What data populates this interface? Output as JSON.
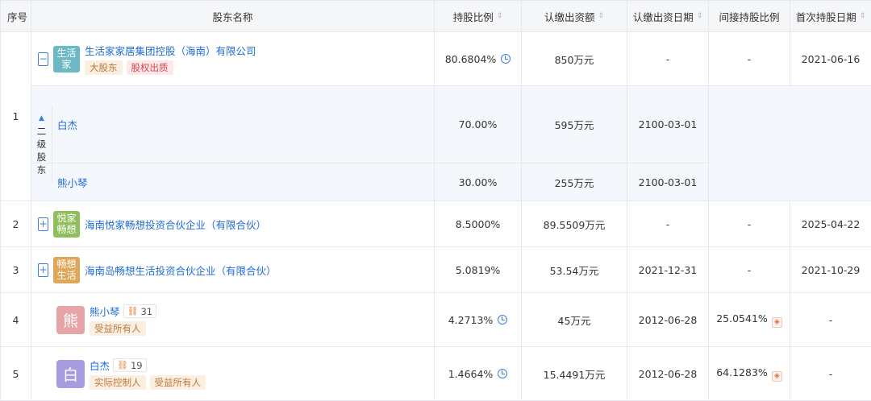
{
  "headers": {
    "index": "序号",
    "name": "股东名称",
    "share_ratio": "持股比例",
    "subscribed_amount": "认缴出资额",
    "subscribed_date": "认缴出资日期",
    "indirect_ratio": "间接持股比例",
    "first_hold_date": "首次持股日期"
  },
  "level_label": [
    "二",
    "级",
    "股",
    "东"
  ],
  "rows": [
    {
      "index": "1",
      "toggle": "−",
      "logo_text": "生活家",
      "logo_color": "#6bb9c4",
      "name": "生活家家居集团控股（海南）有限公司",
      "tags": [
        "大股东",
        "股权出质"
      ],
      "share_ratio": "80.6804%",
      "subscribed_amount": "850万元",
      "subscribed_date": "-",
      "indirect_ratio": "-",
      "first_hold_date": "2021-06-16",
      "children": [
        {
          "name": "白杰",
          "share_ratio": "70.00%",
          "subscribed_amount": "595万元",
          "subscribed_date": "2100-03-01"
        },
        {
          "name": "熊小琴",
          "share_ratio": "30.00%",
          "subscribed_amount": "255万元",
          "subscribed_date": "2100-03-01"
        }
      ]
    },
    {
      "index": "2",
      "toggle": "+",
      "logo_text": "悦家畅想",
      "logo_color": "#8fbf5a",
      "name": "海南悦家畅想投资合伙企业（有限合伙）",
      "share_ratio": "8.5000%",
      "subscribed_amount": "89.5509万元",
      "subscribed_date": "-",
      "indirect_ratio": "-",
      "first_hold_date": "2025-04-22"
    },
    {
      "index": "3",
      "toggle": "+",
      "logo_text": "畅想生活",
      "logo_color": "#e0a75a",
      "name": "海南岛畅想生活投资合伙企业（有限合伙）",
      "share_ratio": "5.0819%",
      "subscribed_amount": "53.54万元",
      "subscribed_date": "2021-12-31",
      "indirect_ratio": "-",
      "first_hold_date": "2021-10-29"
    },
    {
      "index": "4",
      "avatar_text": "熊",
      "avatar_color": "#e7a4a8",
      "name": "熊小琴",
      "count": "31",
      "tags": [
        "受益所有人"
      ],
      "share_ratio": "4.2713%",
      "subscribed_amount": "45万元",
      "subscribed_date": "2012-06-28",
      "indirect_ratio": "25.0541%",
      "first_hold_date": "-"
    },
    {
      "index": "5",
      "avatar_text": "白",
      "avatar_color": "#a99be0",
      "name": "白杰",
      "count": "19",
      "tags": [
        "实际控制人",
        "受益所有人"
      ],
      "share_ratio": "1.4664%",
      "subscribed_amount": "15.4491万元",
      "subscribed_date": "2012-06-28",
      "indirect_ratio": "64.1283%",
      "first_hold_date": "-"
    }
  ]
}
